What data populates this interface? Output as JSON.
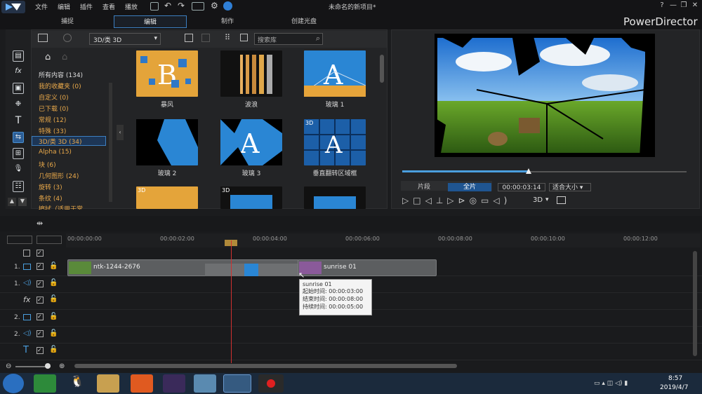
{
  "window": {
    "title": "未命名的新项目*",
    "brand": "PowerDirector",
    "menu": [
      "文件",
      "编辑",
      "插件",
      "查看",
      "播放"
    ],
    "controls": {
      "help": "?",
      "minimize": "—",
      "restore": "❐",
      "close": "✕"
    }
  },
  "mode_tabs": [
    {
      "label": "捕捉",
      "active": false
    },
    {
      "label": "编辑",
      "active": true
    },
    {
      "label": "制作",
      "active": false
    },
    {
      "label": "创建光盘",
      "active": false
    }
  ],
  "library": {
    "category_select": "3D/类 3D",
    "search_placeholder": "搜索库",
    "categories": [
      {
        "label": "所有内容 (134)",
        "selected": false
      },
      {
        "label": "我的收藏夹 (0)",
        "selected": false
      },
      {
        "label": "自定义 (0)",
        "selected": false
      },
      {
        "label": "已下载 (0)",
        "selected": false
      },
      {
        "label": "常规 (12)",
        "selected": false
      },
      {
        "label": "特殊 (33)",
        "selected": false
      },
      {
        "label": "3D/类 3D (34)",
        "selected": true
      },
      {
        "label": "Alpha (15)",
        "selected": false
      },
      {
        "label": "块 (6)",
        "selected": false
      },
      {
        "label": "几何图形 (24)",
        "selected": false
      },
      {
        "label": "旋转 (3)",
        "selected": false
      },
      {
        "label": "条纹 (4)",
        "selected": false
      },
      {
        "label": "擦拭（适用于常",
        "selected": false
      }
    ],
    "transitions": [
      {
        "label": "暴风"
      },
      {
        "label": "波浪"
      },
      {
        "label": "玻璃 1"
      },
      {
        "label": "玻璃 2"
      },
      {
        "label": "玻璃 3"
      },
      {
        "label": "垂直翻转区域框"
      },
      {
        "label": "",
        "badge": "3D"
      },
      {
        "label": "",
        "badge": "3D"
      },
      {
        "label": ""
      }
    ],
    "badge_3d": "3D"
  },
  "preview": {
    "clip_tab": "片段",
    "full_tab": "全片",
    "timecode": "00:00:03:14",
    "zoom": "适合大小",
    "mode_3d": "3D",
    "progress": 0.44
  },
  "timeline": {
    "ruler": [
      "00:00:00:00",
      "00:00:02:00",
      "00:00:04:00",
      "00:00:06:00",
      "00:00:08:00",
      "00:00:10:00",
      "00:00:12:00"
    ],
    "tracks": [
      {
        "label": "1.",
        "type": "video"
      },
      {
        "label": "1.",
        "type": "audio"
      },
      {
        "label": "",
        "type": "fx"
      },
      {
        "label": "2.",
        "type": "video"
      },
      {
        "label": "2.",
        "type": "audio"
      },
      {
        "label": "",
        "type": "title"
      }
    ],
    "clips": [
      {
        "label": "ntk-1244-2676"
      },
      {
        "label": "sunrise 01"
      }
    ],
    "tooltip": {
      "name": "sunrise 01",
      "start": "起始时间: 00:00:03:00",
      "end": "结束时间: 00:00:08:00",
      "duration": "持续时间: 00:00:05:00"
    }
  },
  "taskbar": {
    "time": "8:57",
    "date": "2019/4/7"
  },
  "colors": {
    "accent": "#3c7fc1",
    "category_text": "#e8a84a",
    "playhead": "#d03030"
  }
}
